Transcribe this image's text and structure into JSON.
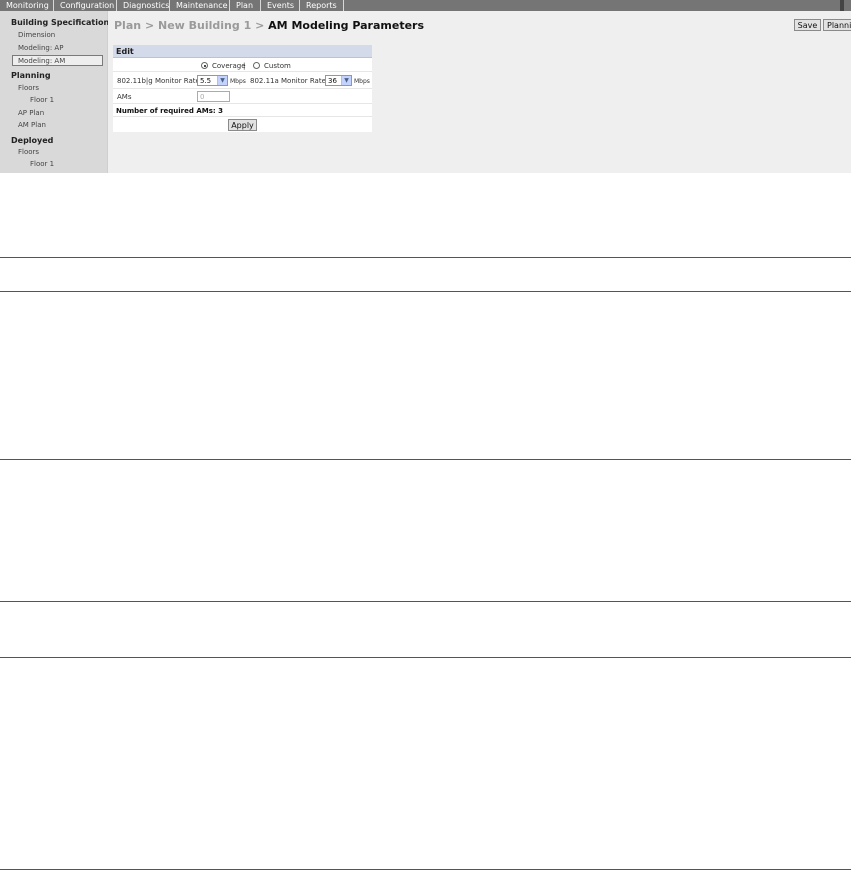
{
  "nav": {
    "tabs": [
      "Monitoring",
      "Configuration",
      "Diagnostics",
      "Maintenance",
      "Plan",
      "Events",
      "Reports"
    ]
  },
  "sidebar": {
    "building_spec": "Building Specification",
    "dimension": "Dimension",
    "modeling_ap": "Modeling: AP",
    "modeling_am": "Modeling: AM",
    "planning": "Planning",
    "planning_floors": "Floors",
    "planning_floor1": "Floor 1",
    "ap_plan": "AP Plan",
    "am_plan": "AM Plan",
    "deployed": "Deployed",
    "deployed_floors": "Floors",
    "deployed_floor1": "Floor 1"
  },
  "breadcrumb": {
    "plan": "Plan",
    "sep": ">",
    "building": "New Building 1",
    "current": "AM Modeling Parameters"
  },
  "toolbar": {
    "save": "Save",
    "planning": "Planning"
  },
  "edit": {
    "title": "Edit",
    "coverage": "Coverage",
    "divider": "|",
    "custom": "Custom",
    "bgb_label": "802.11b|g Monitor Rate",
    "bgb_value": "5.5",
    "bgb_unit": "Mbps",
    "a_label": "802.11a Monitor Rate",
    "a_value": "36",
    "a_unit": "Mbps",
    "ams_label": "AMs",
    "ams_value": "0",
    "required_text": "Number of required AMs: 3",
    "apply": "Apply"
  }
}
